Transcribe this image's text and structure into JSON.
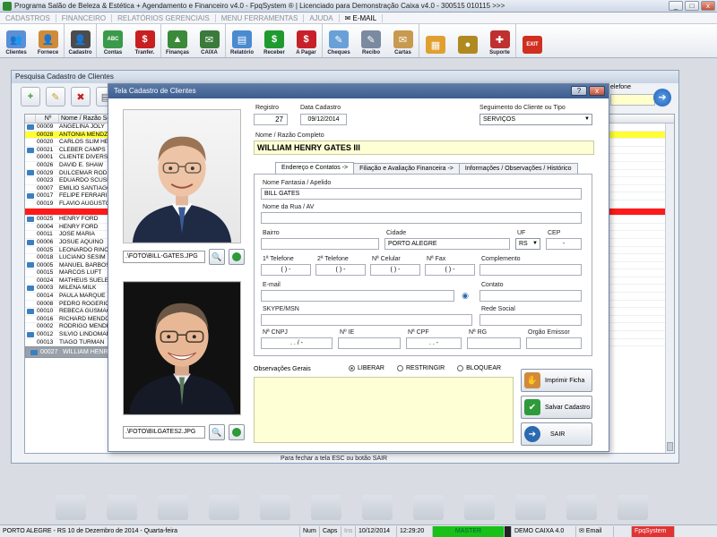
{
  "window": {
    "title": "Programa Salão de Beleza & Estética + Agendamento e Financeiro v4.0 - FpqSystem ® | Licenciado para  Demonstração Caixa v4.0 - 300515 010115 >>>",
    "controls": [
      "_",
      "□",
      "x"
    ]
  },
  "menu": [
    "CADASTROS",
    "FINANCEIRO",
    "RELATÓRIOS GERENCIAIS",
    "MENU FERRAMENTAS",
    "AJUDA",
    "E-MAIL"
  ],
  "toolbar": [
    {
      "label": "Clientes",
      "icon": "people-icon",
      "color": "#5b8fd6",
      "glyph": "👥"
    },
    {
      "label": "Fornece",
      "icon": "person-icon",
      "color": "#d08a3a",
      "glyph": "👤"
    },
    {
      "label": "Cadastro",
      "icon": "user-card-icon",
      "color": "#4c4c4c",
      "glyph": "👤"
    },
    {
      "label": "Contas",
      "icon": "calendar-icon",
      "color": "#3a9a4a",
      "glyph": "ABC"
    },
    {
      "label": "Tranfer.",
      "icon": "transfer-icon",
      "color": "#c82020",
      "glyph": "$"
    },
    {
      "label": "Finanças",
      "icon": "chart-icon",
      "color": "#3a8a3a",
      "glyph": "▲"
    },
    {
      "label": "CAIXA",
      "icon": "cashbox-icon",
      "color": "#3a7a3a",
      "glyph": "✉"
    },
    {
      "label": "Relatório",
      "icon": "report-icon",
      "color": "#4a8ad0",
      "glyph": "▤"
    },
    {
      "label": "Receber",
      "icon": "receive-money-icon",
      "color": "#1f9a2f",
      "glyph": "$"
    },
    {
      "label": "A Pagar",
      "icon": "pay-money-icon",
      "color": "#c8202a",
      "glyph": "$"
    },
    {
      "label": "Cheques",
      "icon": "cheque-icon",
      "color": "#6aa0d8",
      "glyph": "✎"
    },
    {
      "label": "Recibo",
      "icon": "receipt-icon",
      "color": "#7a8aa0",
      "glyph": "✎"
    },
    {
      "label": "Cartas",
      "icon": "letter-icon",
      "color": "#c89a50",
      "glyph": "✉"
    },
    {
      "label": "",
      "icon": "calculator-icon",
      "color": "#e0a030",
      "glyph": "▦"
    },
    {
      "label": "",
      "icon": "coins-icon",
      "color": "#b08a20",
      "glyph": "●"
    },
    {
      "label": "Suporte",
      "icon": "support-icon",
      "color": "#c03030",
      "glyph": "✚"
    },
    {
      "label": "",
      "icon": "exit-icon",
      "color": "#d03020",
      "glyph": "EXIT"
    }
  ],
  "bg_window": {
    "title": "Pesquisa Cadastro de Clientes",
    "phone_label": "elefone",
    "columns": [
      "Nº",
      "Nome / Razão Soci"
    ],
    "rows": [
      {
        "code": "00009",
        "name": "ANGELINA JOLY",
        "state": ""
      },
      {
        "code": "00028",
        "name": "ANTONIA MENDZ",
        "state": "yellow"
      },
      {
        "code": "00020",
        "name": "CARLOS SLIM HEL",
        "state": ""
      },
      {
        "code": "00021",
        "name": "CLEBER CAMPS",
        "state": ""
      },
      {
        "code": "00001",
        "name": "CLIENTE DIVERSO",
        "state": ""
      },
      {
        "code": "00026",
        "name": "DAVID E. SHAW",
        "state": ""
      },
      {
        "code": "00029",
        "name": "DULCEMAR RODR",
        "state": ""
      },
      {
        "code": "00023",
        "name": "EDUARDO SCUSIA",
        "state": ""
      },
      {
        "code": "00007",
        "name": "EMILIO SANTIAGO",
        "state": ""
      },
      {
        "code": "00017",
        "name": "FELIPE FERRARI",
        "state": ""
      },
      {
        "code": "00019",
        "name": "FLAVIO AUGUSTO",
        "state": ""
      },
      {
        "code": "00022",
        "name": "",
        "state": "red"
      },
      {
        "code": "00025",
        "name": "HENRY FORD",
        "state": ""
      },
      {
        "code": "00004",
        "name": "HENRY FORD",
        "state": ""
      },
      {
        "code": "00011",
        "name": "JOSE MARIA",
        "state": ""
      },
      {
        "code": "00006",
        "name": "JOSUE AQUINO",
        "state": ""
      },
      {
        "code": "00025",
        "name": "LEONARDO RINO",
        "state": ""
      },
      {
        "code": "00018",
        "name": "LUCIANO SESIM",
        "state": ""
      },
      {
        "code": "00005",
        "name": "MANUEL BARBOS",
        "state": ""
      },
      {
        "code": "00015",
        "name": "MARCOS LUFT",
        "state": ""
      },
      {
        "code": "00024",
        "name": "MATHEUS SUELEN",
        "state": ""
      },
      {
        "code": "00003",
        "name": "MILENA MILK",
        "state": ""
      },
      {
        "code": "00014",
        "name": "PAULA MARQUE",
        "state": ""
      },
      {
        "code": "00008",
        "name": "PEDRO ROGERIO",
        "state": ""
      },
      {
        "code": "00010",
        "name": "REBECA GUSMÃO",
        "state": ""
      },
      {
        "code": "00016",
        "name": "RICHARD MENDON",
        "state": ""
      },
      {
        "code": "00002",
        "name": "RODRIGO MENDE",
        "state": ""
      },
      {
        "code": "00012",
        "name": "SILVIO LINDOMAR",
        "state": ""
      },
      {
        "code": "00013",
        "name": "TIAGO TURMAN",
        "state": ""
      },
      {
        "code": "00027",
        "name": "WILLIAM HENRY G",
        "state": "sel"
      }
    ],
    "close_hint": "Para fechar a tela ESC ou botão SAIR"
  },
  "dialog": {
    "title": "Tela Cadastro de Clientes",
    "photo1_path": ".\\FOTO\\BILL-GATES.JPG",
    "photo2_path": ".\\FOTO\\BILGATES2.JPG",
    "registro_label": "Registro",
    "registro_value": "27",
    "data_label": "Data Cadastro",
    "data_value": "09/12/2014",
    "segmento_label": "Seguimento do Cliente ou Tipo",
    "segmento_value": "SERVIÇOS",
    "nome_label": "Nome / Razão Completo",
    "nome_value": "WILLIAM HENRY GATES III",
    "tabs": [
      "Endereço e Contatos ->",
      "Filiação e Avaliação Financeira ->",
      "Informações / Observações / Histórico"
    ],
    "fields": {
      "fantasia_label": "Nome Fantasia / Apelido",
      "fantasia_value": "BILL GATES",
      "rua_label": "Nome da Rua / AV",
      "bairro_label": "Bairro",
      "cidade_label": "Cidade",
      "cidade_value": "PORTO ALEGRE",
      "uf_label": "UF",
      "uf_value": "RS",
      "cep_label": "CEP",
      "cep_mask": "-",
      "tel1_label": "1ª Telefone",
      "tel2_label": "2ª Telefone",
      "cel_label": "Nª Celular",
      "fax_label": "Nª Fax",
      "phone_mask": "(  )    -",
      "complemento_label": "Complemento",
      "email_label": "E-mail",
      "contato_label": "Contato",
      "skype_label": "SKYPE/MSN",
      "social_label": "Rede Social",
      "cnpj_label": "Nª CNPJ",
      "cnpj_mask": ".   .   /   -",
      "ie_label": "Nº IE",
      "cpf_label": "Nª CPF",
      "cpf_mask": ".   .   -",
      "rg_label": "Nª RG",
      "orgao_label": "Orgão Emissor"
    },
    "obs_label": "Observações Gerais",
    "radios": [
      {
        "label": "LIBERAR",
        "on": true
      },
      {
        "label": "RESTRINGIR",
        "on": false
      },
      {
        "label": "BLOQUEAR",
        "on": false
      }
    ],
    "buttons": {
      "print": "Imprimir Ficha",
      "save": "Salvar Cadastro",
      "exit": "SAIR"
    }
  },
  "status": {
    "location": "PORTO ALEGRE - RS 10 de Dezembro de 2014 - Quarta-feira",
    "num": "Num",
    "caps": "Caps",
    "ins": "Ins",
    "date": "10/12/2014",
    "time": "12:29:20",
    "master": "MASTER",
    "demo": "DEMO CAIXA 4.0",
    "email": "Email",
    "brand": "FpqSystem"
  }
}
